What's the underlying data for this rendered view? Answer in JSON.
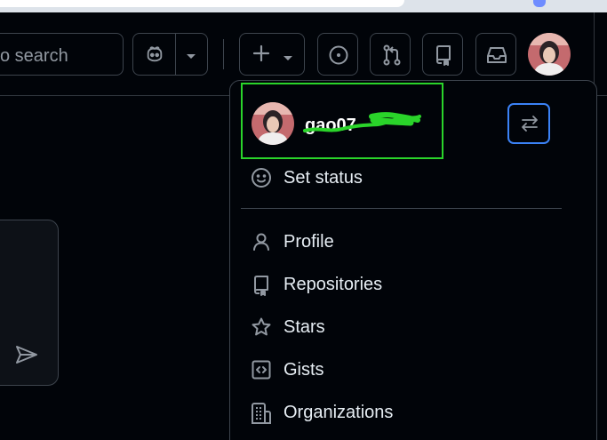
{
  "search": {
    "text": "o search"
  },
  "user": {
    "username": "gao07"
  },
  "menu": {
    "set_status": "Set status",
    "items": [
      {
        "label": "Profile",
        "icon": "person-icon"
      },
      {
        "label": "Repositories",
        "icon": "repo-icon"
      },
      {
        "label": "Stars",
        "icon": "star-icon"
      },
      {
        "label": "Gists",
        "icon": "code-square-icon"
      },
      {
        "label": "Organizations",
        "icon": "organization-icon"
      }
    ]
  },
  "colors": {
    "background": "#010409",
    "border": "#3d444d",
    "text": "#e6edf3",
    "muted": "#9198a1",
    "highlight_box": "#2ad42a",
    "switch_border": "#3b82f6"
  }
}
